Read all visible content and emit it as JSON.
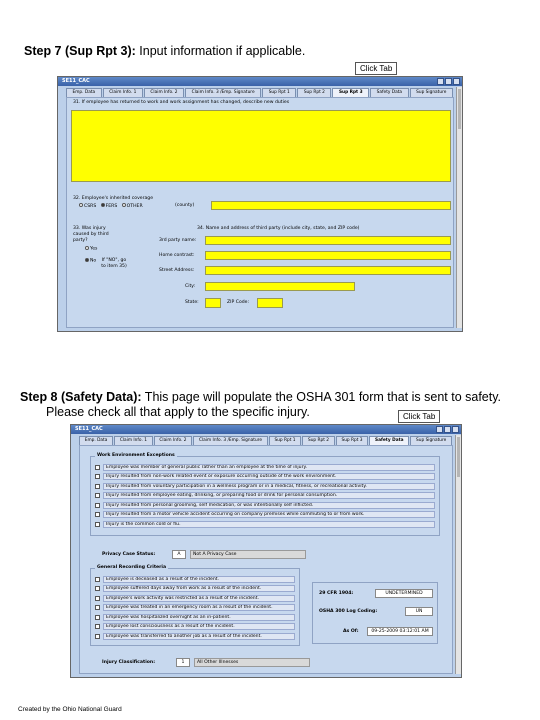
{
  "step7": {
    "label": "Step 7 (Sup Rpt 3):",
    "text": " Input information if applicable.",
    "callout": "Click Tab"
  },
  "step8": {
    "label": "Step 8 (Safety Data):",
    "text": " This page will populate the OSHA 301 form that is sent to safety.",
    "line2": "Please check all that apply to the specific injury.",
    "callout": "Click Tab"
  },
  "shot1": {
    "title": "SE11_CAC",
    "tabs": [
      "Emp. Data",
      "Claim Info. 1",
      "Claim Info. 2",
      "Claim Info. 3 /Emp. Signature",
      "Sup Rpt 1",
      "Sup Rpt 2",
      "Sup Rpt 3",
      "Safety Data",
      "Sup Signature"
    ],
    "active_tab": 6,
    "q31": "31. If employee has returned to work and work assignment has changed, describe new duties",
    "q32": "32. Employee's inherited coverage",
    "coverage_options": [
      "CSRS",
      "FERS",
      "OTHER"
    ],
    "coverage_selected": 1,
    "county_label": "(county)",
    "q33": "33. Was injury caused by third party?",
    "q33_options": [
      "Yes",
      "No"
    ],
    "q33_selected": 1,
    "q33_note": "If \"NO\", go to item 35)",
    "q34": "34. Name and address of third party (include city, state, and ZIP code)",
    "fields": [
      "3rd party name:",
      "Home contrast:",
      "Street Address:",
      "City:"
    ],
    "state_label": "State:",
    "zip_label": "ZIP Code:"
  },
  "shot2": {
    "title": "SE11_CAC",
    "tabs": [
      "Emp. Data",
      "Claim Info. 1",
      "Claim Info. 2",
      "Claim Info. 3 /Emp. Signature",
      "Sup Rpt 1",
      "Sup Rpt 2",
      "Sup Rpt 3",
      "Safety Data",
      "Sup Signature"
    ],
    "active_tab": 7,
    "work_env_title": "Work Environment Exceptions",
    "work_env_items": [
      "Employee was member of general public rather than an employee at the time of injury.",
      "Injury resulted from non-work related event or exposure occurring outside of the work environment.",
      "Injury resulted from voluntary participation in a wellness program or in a medical, fitness, or recreational activity.",
      "Injury resulted from employee eating, drinking, or preparing food or drink for personal consumption.",
      "Injury resulted from personal grooming, self medication, or was intentionally self inflicted.",
      "Injury resulted from a motor vehicle accident occurring on company premises while commuting to or from work.",
      "Injury is the common cold or flu."
    ],
    "privacy_label": "Privacy Case Status:",
    "privacy_code": "A",
    "privacy_value": "Not A Privacy Case",
    "recording_title": "General Recording Criteria",
    "recording_items": [
      "Employee is deceased as a result of the incident.",
      "Employee suffered days away from work as a result of the incident.",
      "Employee's work activity was restricted as a result of the incident.",
      "Employee was treated in an emergency room as a result of the incident.",
      "Employee was hospitalized overnight as an in-patient.",
      "Employee lost consciousness as a result of the incident.",
      "Employee was transferred to another job as a result of the incident."
    ],
    "cfr_label": "29 CFR 1904:",
    "cfr_value": "UNDETERMINED",
    "osha_label": "OSHA 300 Log Coding:",
    "osha_value": "UN",
    "as_of_label": "As Of:",
    "as_of_value": "09-25-2009 03:12:01 AM",
    "injury_label": "Injury Classification:",
    "injury_code": "1",
    "injury_value": "All Other Illnesses"
  },
  "footer": "Created by the Ohio National Guard"
}
